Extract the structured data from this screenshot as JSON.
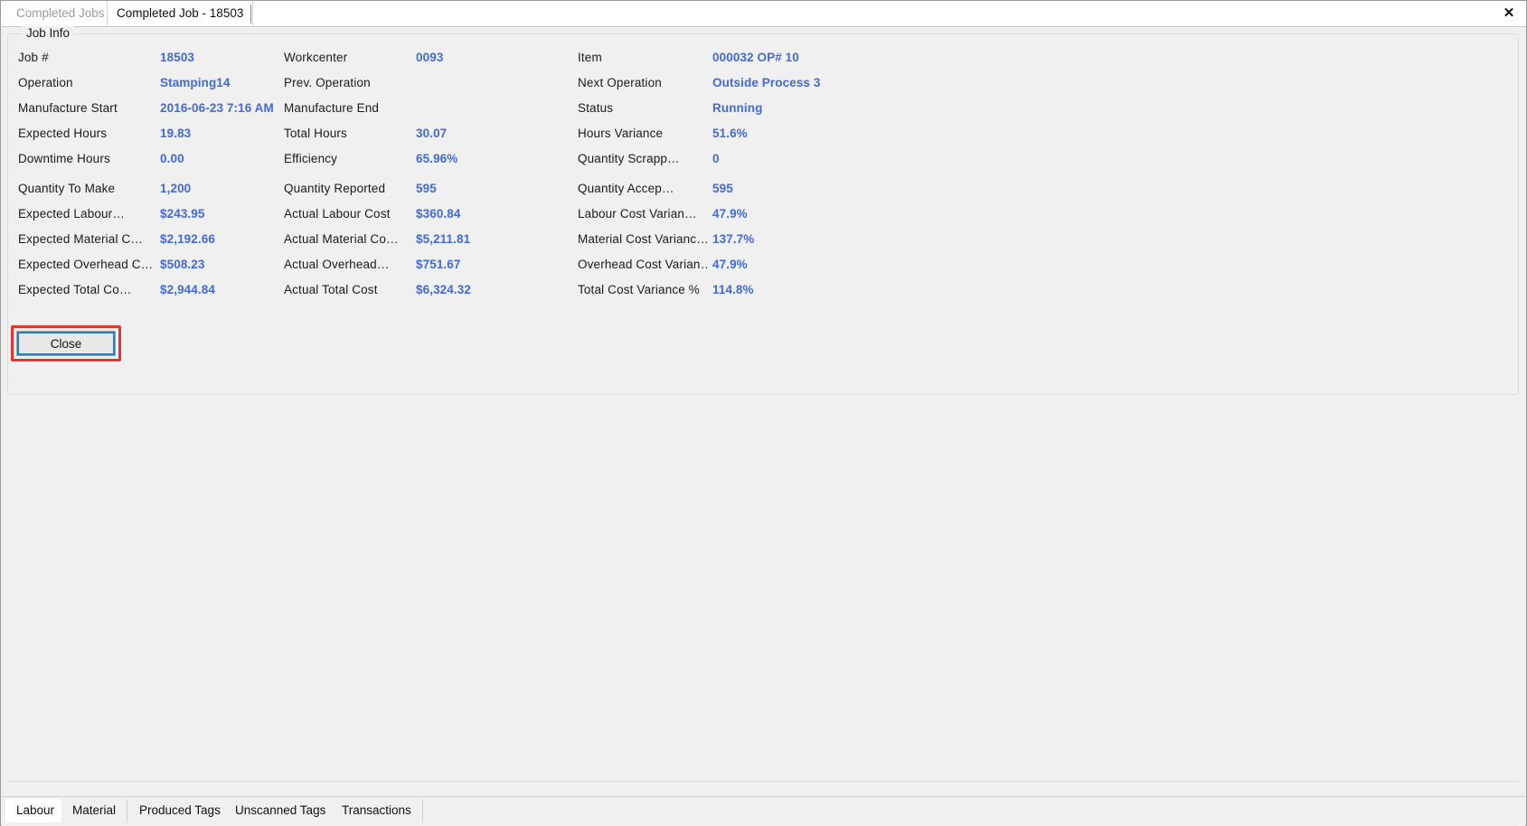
{
  "window": {
    "close_icon": "close-x-icon",
    "close_glyph": "✕"
  },
  "top_tabs": [
    {
      "label": "Completed Jobs",
      "active": false
    },
    {
      "label": "Completed Job - 18503",
      "active": true
    }
  ],
  "group": {
    "legend": "Job Info"
  },
  "fields": [
    {
      "col1_label": "Job #",
      "col1_value": "18503",
      "col2_label": "Workcenter",
      "col2_value": "0093",
      "col3_label": "Item",
      "col3_value": "000032 OP# 10"
    },
    {
      "col1_label": "Operation",
      "col1_value": "Stamping14",
      "col2_label": "Prev. Operation",
      "col2_value": "",
      "col3_label": "Next Operation",
      "col3_value": "Outside Process 3"
    },
    {
      "col1_label": "Manufacture Start",
      "col1_value": "2016-06-23 7:16 AM",
      "col2_label": "Manufacture End",
      "col2_value": "",
      "col3_label": "Status",
      "col3_value": "Running"
    },
    {
      "col1_label": "Expected Hours",
      "col1_value": "19.83",
      "col2_label": "Total Hours",
      "col2_value": "30.07",
      "col3_label": "Hours Variance",
      "col3_value": "51.6%"
    },
    {
      "col1_label": "Downtime Hours",
      "col1_value": "0.00",
      "col2_label": "Efficiency",
      "col2_value": "65.96%",
      "col3_label": "Quantity Scrapp…",
      "col3_value": "0"
    },
    {
      "col1_label": "Quantity To Make",
      "col1_value": "1,200",
      "col2_label": "Quantity Reported",
      "col2_value": "595",
      "col3_label": "Quantity Accep…",
      "col3_value": "595"
    },
    {
      "col1_label": "Expected  Labour…",
      "col1_value": "$243.95",
      "col2_label": "Actual Labour Cost",
      "col2_value": "$360.84",
      "col3_label": "Labour Cost Varian…",
      "col3_value": "47.9%"
    },
    {
      "col1_label": "Expected Material C…",
      "col1_value": "$2,192.66",
      "col2_label": "Actual Material Co…",
      "col2_value": "$5,211.81",
      "col3_label": "Material Cost Varianc…",
      "col3_value": "137.7%"
    },
    {
      "col1_label": "Expected Overhead C…",
      "col1_value": "$508.23",
      "col2_label": "Actual Overhead…",
      "col2_value": "$751.67",
      "col3_label": "Overhead Cost Varian…",
      "col3_value": "47.9%"
    },
    {
      "col1_label": "Expected Total Co…",
      "col1_value": "$2,944.84",
      "col2_label": "Actual Total Cost",
      "col2_value": "$6,324.32",
      "col3_label": "Total Cost Variance %",
      "col3_value": "114.8%"
    }
  ],
  "close_button": {
    "label": "Close"
  },
  "bottom_tabs": [
    {
      "label": "Labour",
      "active": true
    },
    {
      "label": "Material",
      "active": false
    },
    {
      "label": "Produced Tags",
      "active": false
    },
    {
      "label": "Unscanned Tags",
      "active": false
    },
    {
      "label": "Transactions",
      "active": false
    }
  ],
  "colors": {
    "value_blue": "#4169e1",
    "highlight_red": "#e8332a",
    "focus_blue": "#1f7fd4",
    "window_bg": "#f0f0f0"
  }
}
